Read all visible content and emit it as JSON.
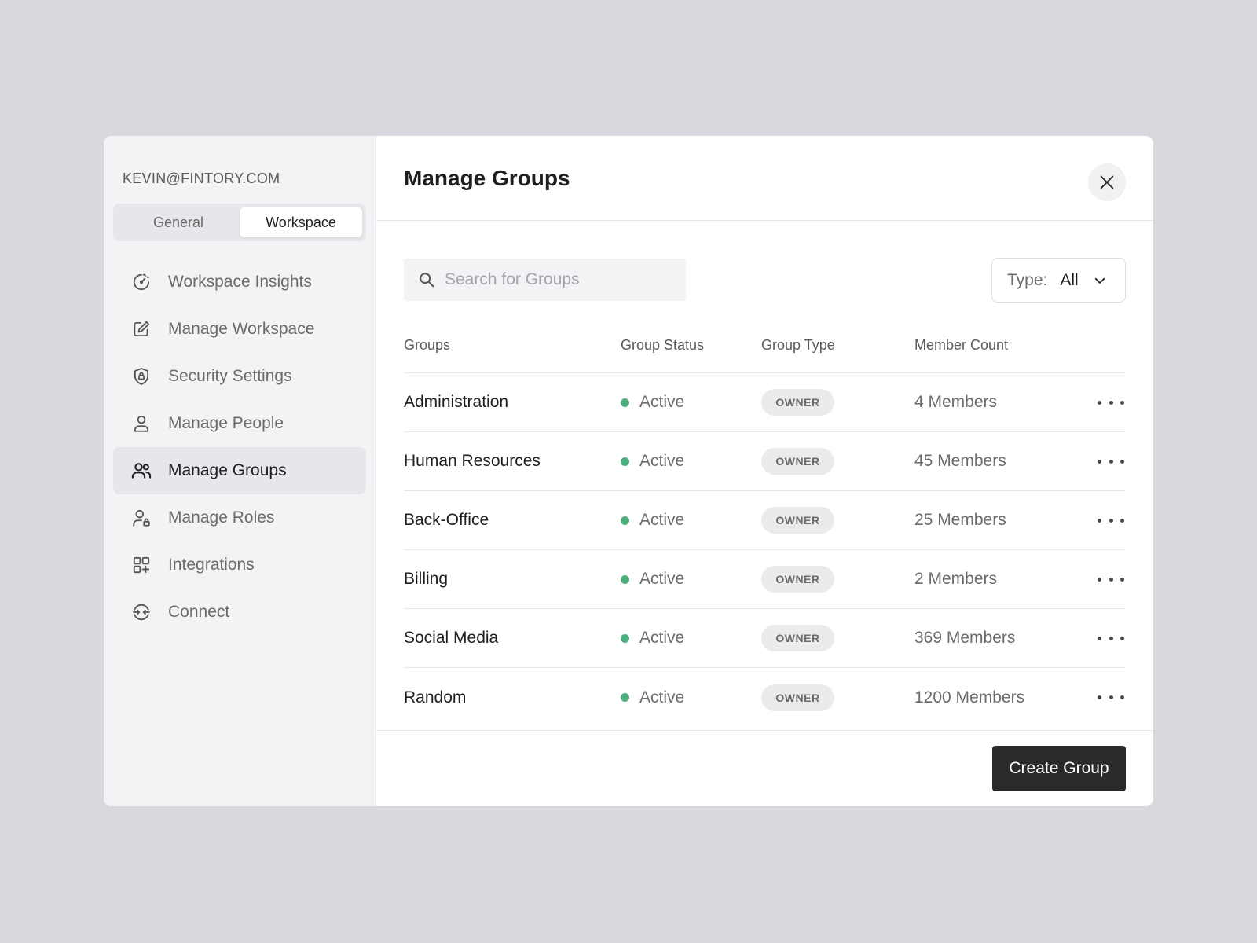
{
  "account": "KEVIN@FINTORY.COM",
  "tabs": [
    {
      "label": "General",
      "active": false
    },
    {
      "label": "Workspace",
      "active": true
    }
  ],
  "sidebar": {
    "items": [
      {
        "label": "Workspace Insights",
        "icon": "insights-gauge-icon",
        "active": false
      },
      {
        "label": "Manage Workspace",
        "icon": "edit-icon",
        "active": false
      },
      {
        "label": "Security Settings",
        "icon": "shield-lock-icon",
        "active": false
      },
      {
        "label": "Manage People",
        "icon": "user-icon",
        "active": false
      },
      {
        "label": "Manage Groups",
        "icon": "users-icon",
        "active": true
      },
      {
        "label": "Manage Roles",
        "icon": "user-lock-icon",
        "active": false
      },
      {
        "label": "Integrations",
        "icon": "grid-add-icon",
        "active": false
      },
      {
        "label": "Connect",
        "icon": "connect-icon",
        "active": false
      }
    ]
  },
  "header": {
    "title": "Manage Groups",
    "close_icon": "close-icon"
  },
  "search": {
    "placeholder": "Search for Groups",
    "value": ""
  },
  "filter": {
    "label": "Type:",
    "value": "All"
  },
  "table": {
    "columns": [
      "Groups",
      "Group Status",
      "Group Type",
      "Member Count"
    ],
    "rows": [
      {
        "name": "Administration",
        "status": "Active",
        "type": "OWNER",
        "members": "4 Members"
      },
      {
        "name": "Human Resources",
        "status": "Active",
        "type": "OWNER",
        "members": "45 Members"
      },
      {
        "name": "Back-Office",
        "status": "Active",
        "type": "OWNER",
        "members": "25 Members"
      },
      {
        "name": "Billing",
        "status": "Active",
        "type": "OWNER",
        "members": "2 Members"
      },
      {
        "name": "Social Media",
        "status": "Active",
        "type": "OWNER",
        "members": "369 Members"
      },
      {
        "name": "Random",
        "status": "Active",
        "type": "OWNER",
        "members": "1200 Members"
      }
    ]
  },
  "footer": {
    "create_label": "Create Group"
  },
  "colors": {
    "accent_dark": "#2a2a2a",
    "status_active": "#4caf7d",
    "background": "#d8d9de"
  }
}
